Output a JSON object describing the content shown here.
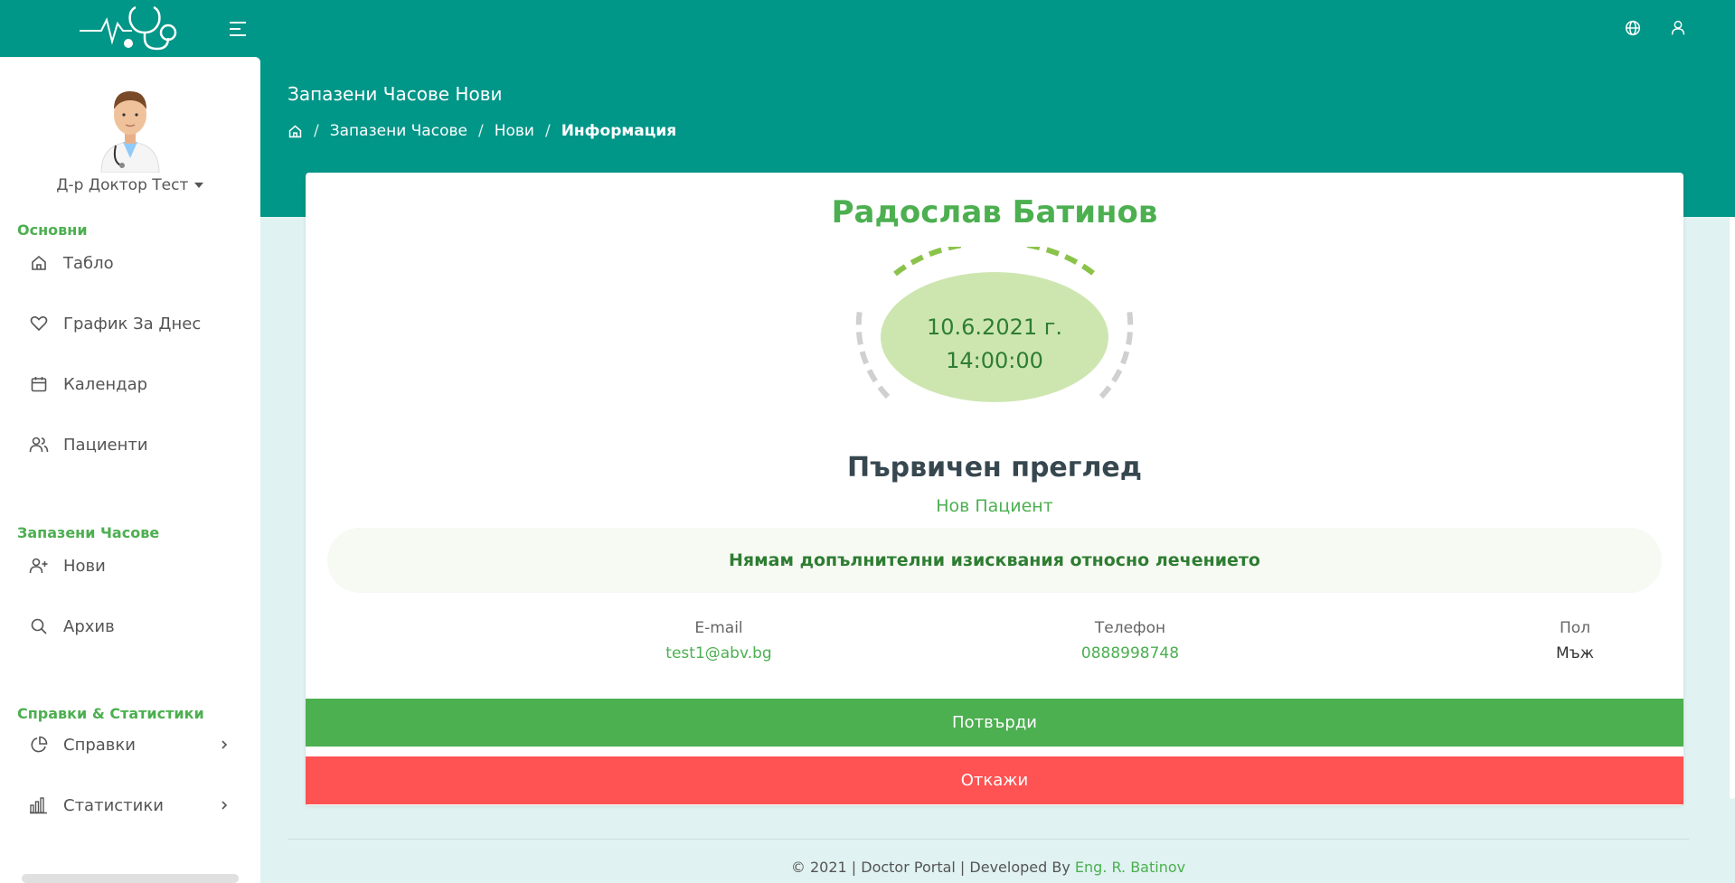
{
  "header": {
    "menu_icon": "menu-icon",
    "language_icon": "globe-icon",
    "user_icon": "user-icon"
  },
  "sidebar": {
    "user_name": "Д-р Доктор Тест",
    "sections": [
      {
        "title": "Основни"
      },
      {
        "title": "Запазени Часове"
      },
      {
        "title": "Справки & Статистики"
      }
    ],
    "items": [
      {
        "label": "Табло",
        "icon": "home-icon"
      },
      {
        "label": "График За Днес",
        "icon": "heart-icon"
      },
      {
        "label": "Календар",
        "icon": "calendar-icon"
      },
      {
        "label": "Пациенти",
        "icon": "users-icon"
      },
      {
        "label": "Нови",
        "icon": "user-plus-icon"
      },
      {
        "label": "Архив",
        "icon": "search-icon"
      },
      {
        "label": "Справки",
        "icon": "pie-chart-icon"
      },
      {
        "label": "Статистики",
        "icon": "bar-chart-icon"
      }
    ]
  },
  "main": {
    "page_title": "Запазени Часове Нови",
    "breadcrumb": [
      "Запазени Часове",
      "Нови",
      "Информация"
    ],
    "appointment": {
      "patient_name": "Радослав Батинов",
      "date": "10.6.2021 г.",
      "time": "14:00:00",
      "exam_type": "Първичен преглед",
      "patient_status": "Нов Пациент",
      "notes": "Нямам допълнителни изисквания относно лечението",
      "email_label": "E-mail",
      "email": "test1@abv.bg",
      "phone_label": "Телефон",
      "phone": "0888998748",
      "gender_label": "Пол",
      "gender": "Мъж",
      "confirm_label": "Потвърди",
      "cancel_label": "Откажи"
    }
  },
  "footer": {
    "text": "© 2021 | Doctor Portal | Developed By",
    "author": "Eng. R. Batinov"
  },
  "colors": {
    "primary": "#009688",
    "accent_green": "#4caf50",
    "danger": "#ff5252"
  }
}
